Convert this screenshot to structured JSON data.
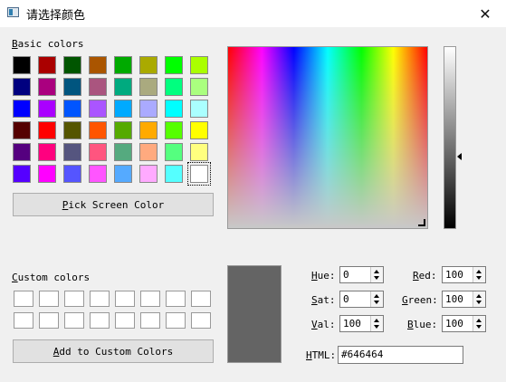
{
  "window": {
    "title": "请选择颜色",
    "close_symbol": "✕"
  },
  "basic_colors": {
    "label": "Basic colors",
    "swatches": [
      "#000000",
      "#aa0000",
      "#005500",
      "#aa5500",
      "#00aa00",
      "#aaaa00",
      "#00ff00",
      "#aaff00",
      "#00007f",
      "#aa007f",
      "#00557f",
      "#aa557f",
      "#00aa7f",
      "#aaaa7f",
      "#00ff7f",
      "#aaff7f",
      "#0000ff",
      "#aa00ff",
      "#0055ff",
      "#aa55ff",
      "#00aaff",
      "#aaaaff",
      "#00ffff",
      "#aaffff",
      "#550000",
      "#ff0000",
      "#555500",
      "#ff5500",
      "#55aa00",
      "#ffaa00",
      "#55ff00",
      "#ffff00",
      "#55007f",
      "#ff007f",
      "#55557f",
      "#ff557f",
      "#55aa7f",
      "#ffaa7f",
      "#55ff7f",
      "#ffff7f",
      "#5500ff",
      "#ff00ff",
      "#5555ff",
      "#ff55ff",
      "#55aaff",
      "#ffaaff",
      "#55ffff",
      "#ffffff"
    ],
    "selected_index": 47
  },
  "pick_screen_button": "Pick Screen Color",
  "custom_colors": {
    "label": "Custom colors",
    "count": 16
  },
  "add_custom_button": "Add to Custom Colors",
  "preview_color": "#646464",
  "fields": {
    "hue": {
      "label": "Hue:",
      "value": "0"
    },
    "sat": {
      "label": "Sat:",
      "value": "0"
    },
    "val": {
      "label": "Val:",
      "value": "100"
    },
    "red": {
      "label": "Red:",
      "value": "100"
    },
    "green": {
      "label": "Green:",
      "value": "100"
    },
    "blue": {
      "label": "Blue:",
      "value": "100"
    },
    "html": {
      "label": "HTML:",
      "value": "#646464"
    }
  }
}
